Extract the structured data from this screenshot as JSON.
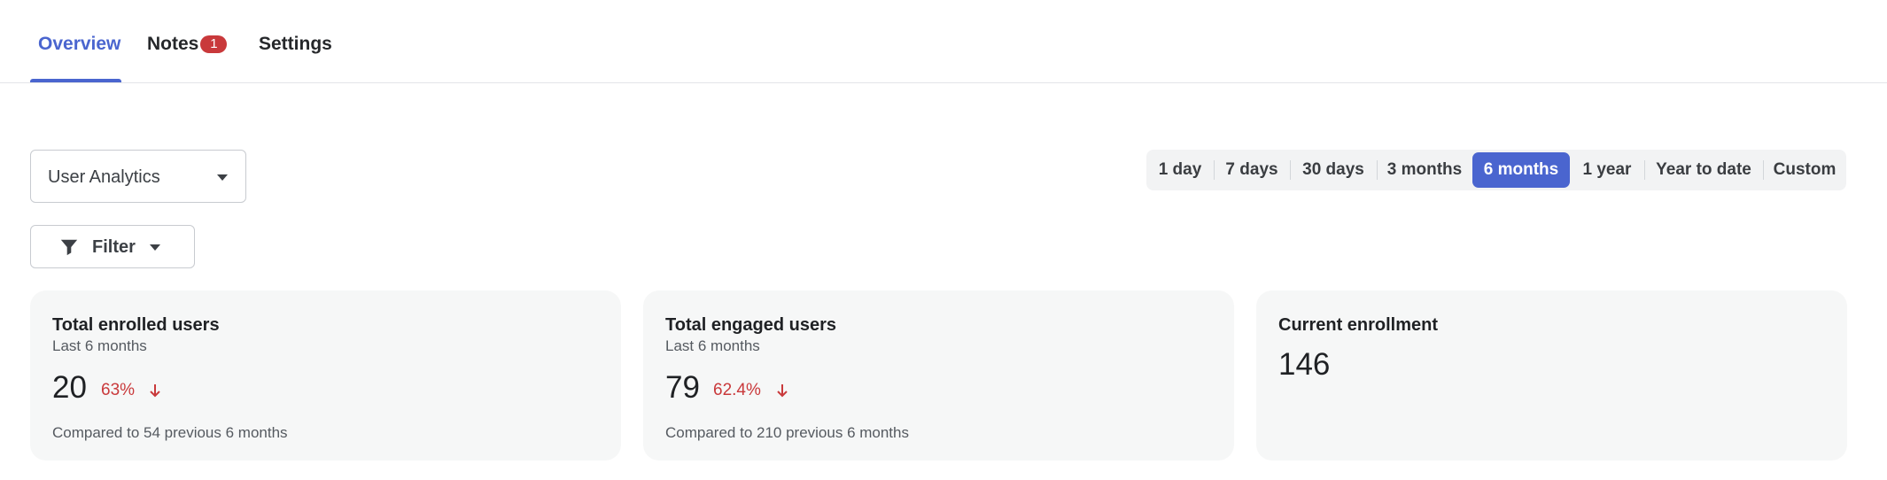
{
  "tabs": {
    "overview": "Overview",
    "notes": "Notes",
    "notes_badge": "1",
    "settings": "Settings"
  },
  "report_select": {
    "value": "User Analytics"
  },
  "filter": {
    "label": "Filter",
    "icon": "funnel-icon"
  },
  "range": {
    "options": [
      "1 day",
      "7 days",
      "30 days",
      "3 months",
      "6 months",
      "1 year",
      "Year to date",
      "Custom"
    ],
    "selected": "6 months"
  },
  "cards": [
    {
      "title": "Total enrolled users",
      "subtitle": "Last 6 months",
      "value": "20",
      "change": "63%",
      "trend": "down",
      "compare": "Compared to 54 previous 6 months"
    },
    {
      "title": "Total engaged users",
      "subtitle": "Last 6 months",
      "value": "79",
      "change": "62.4%",
      "trend": "down",
      "compare": "Compared to 210 previous 6 months"
    },
    {
      "title": "Current enrollment",
      "value": "146"
    }
  ],
  "colors": {
    "accent": "#4a65cf",
    "negative": "#c9393b",
    "card_bg": "#f6f7f7"
  }
}
